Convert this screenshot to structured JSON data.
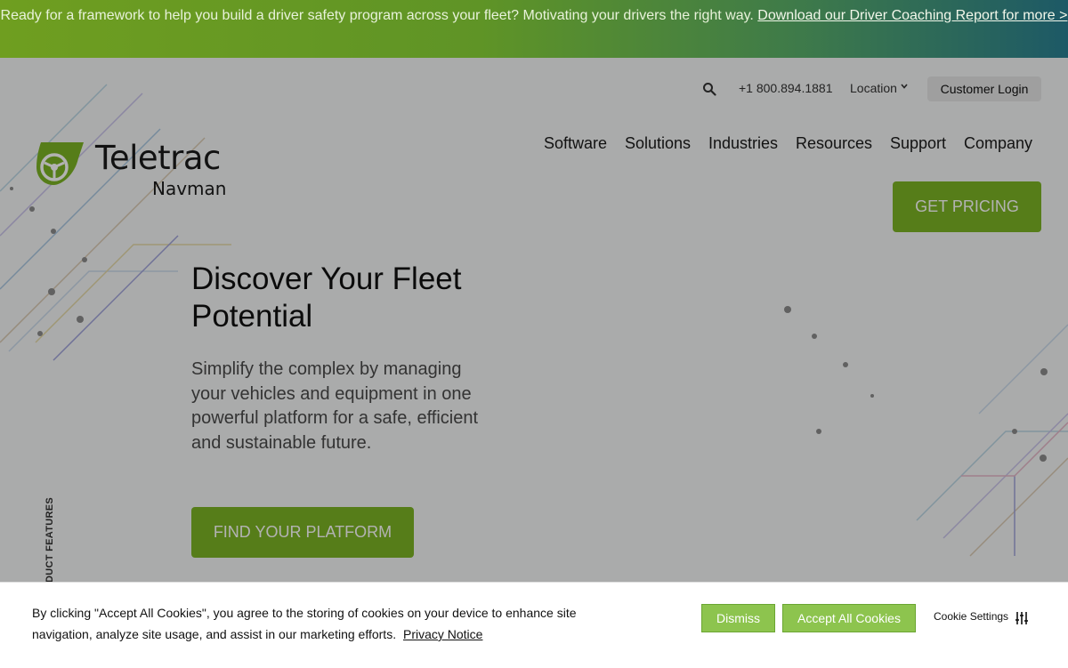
{
  "banner": {
    "text": "Ready for a framework to help you build a driver safety program across your fleet? Motivating your drivers the right way.",
    "link": "Download our Driver Coaching Report for more >"
  },
  "utility": {
    "search_icon": "search-icon",
    "phone": "+1 800.894.1881",
    "location": "Location",
    "login": "Customer Login"
  },
  "logo": {
    "line1": "Teletrac",
    "line2": "Navman"
  },
  "nav": {
    "items": [
      "Software",
      "Solutions",
      "Industries",
      "Resources",
      "Support",
      "Company"
    ]
  },
  "cta": {
    "pricing": "GET PRICING",
    "find_platform": "FIND YOUR PLATFORM"
  },
  "hero": {
    "headline": "Discover Your Fleet Potential",
    "subtext": "Simplify the complex by managing your vehicles and equipment in one powerful platform for a safe, efficient and sustainable future."
  },
  "side_label": "DUCT FEATURES",
  "cookie": {
    "text": "By clicking \"Accept All Cookies\", you agree to the storing of cookies on your device to enhance site navigation, analyze site usage, and assist in our marketing efforts.",
    "privacy_link": "Privacy Notice",
    "dismiss": "Dismiss",
    "accept_all": "Accept All Cookies",
    "settings": "Cookie Settings"
  },
  "colors": {
    "brand_green": "#7cb325",
    "cookie_green": "#8dc44e",
    "banner_end": "#1d5966"
  }
}
